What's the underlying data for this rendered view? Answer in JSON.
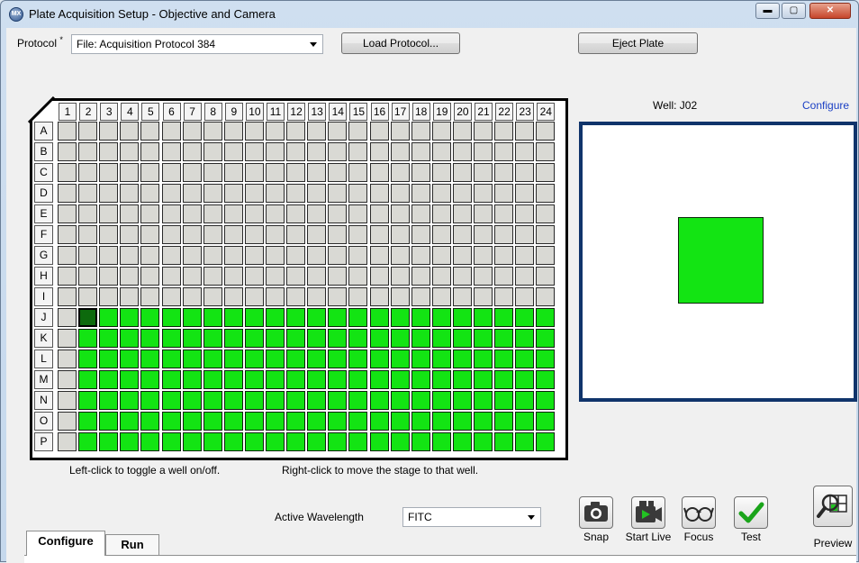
{
  "window": {
    "title": "Plate Acquisition Setup - Objective and Camera",
    "icon_text": "MX",
    "close": "✕",
    "minimize": "▬",
    "maximize": "▢"
  },
  "protocol": {
    "label": "Protocol",
    "required_mark": "*",
    "value": "File: Acquisition Protocol 384",
    "load_button": "Load Protocol...",
    "eject_button": "Eject Plate"
  },
  "plate": {
    "columns": [
      "1",
      "2",
      "3",
      "4",
      "5",
      "6",
      "7",
      "8",
      "9",
      "10",
      "11",
      "12",
      "13",
      "14",
      "15",
      "16",
      "17",
      "18",
      "19",
      "20",
      "21",
      "22",
      "23",
      "24"
    ],
    "rows": [
      "A",
      "B",
      "C",
      "D",
      "E",
      "F",
      "G",
      "H",
      "I",
      "J",
      "K",
      "L",
      "M",
      "N",
      "O",
      "P"
    ],
    "enabled_rows": [
      "J",
      "K",
      "L",
      "M",
      "N",
      "O",
      "P"
    ],
    "enabled_start_column": 2,
    "selected_well": "J02",
    "colors": {
      "on": "#13e413",
      "off": "#d9d9d4",
      "selected": "#0d6a0d"
    }
  },
  "hints": {
    "left_click": "Left-click to toggle a well on/off.",
    "right_click": "Right-click to move the stage to that well."
  },
  "preview_panel": {
    "well_label": "Well: J02",
    "configure_link": "Configure",
    "frame_color": "#10346b"
  },
  "wavelength": {
    "label": "Active Wavelength",
    "value": "FITC"
  },
  "tools": {
    "snap": "Snap",
    "start_live": "Start Live",
    "focus": "Focus",
    "test": "Test",
    "preview": "Preview"
  },
  "tabs": [
    "Configure",
    "Run"
  ]
}
